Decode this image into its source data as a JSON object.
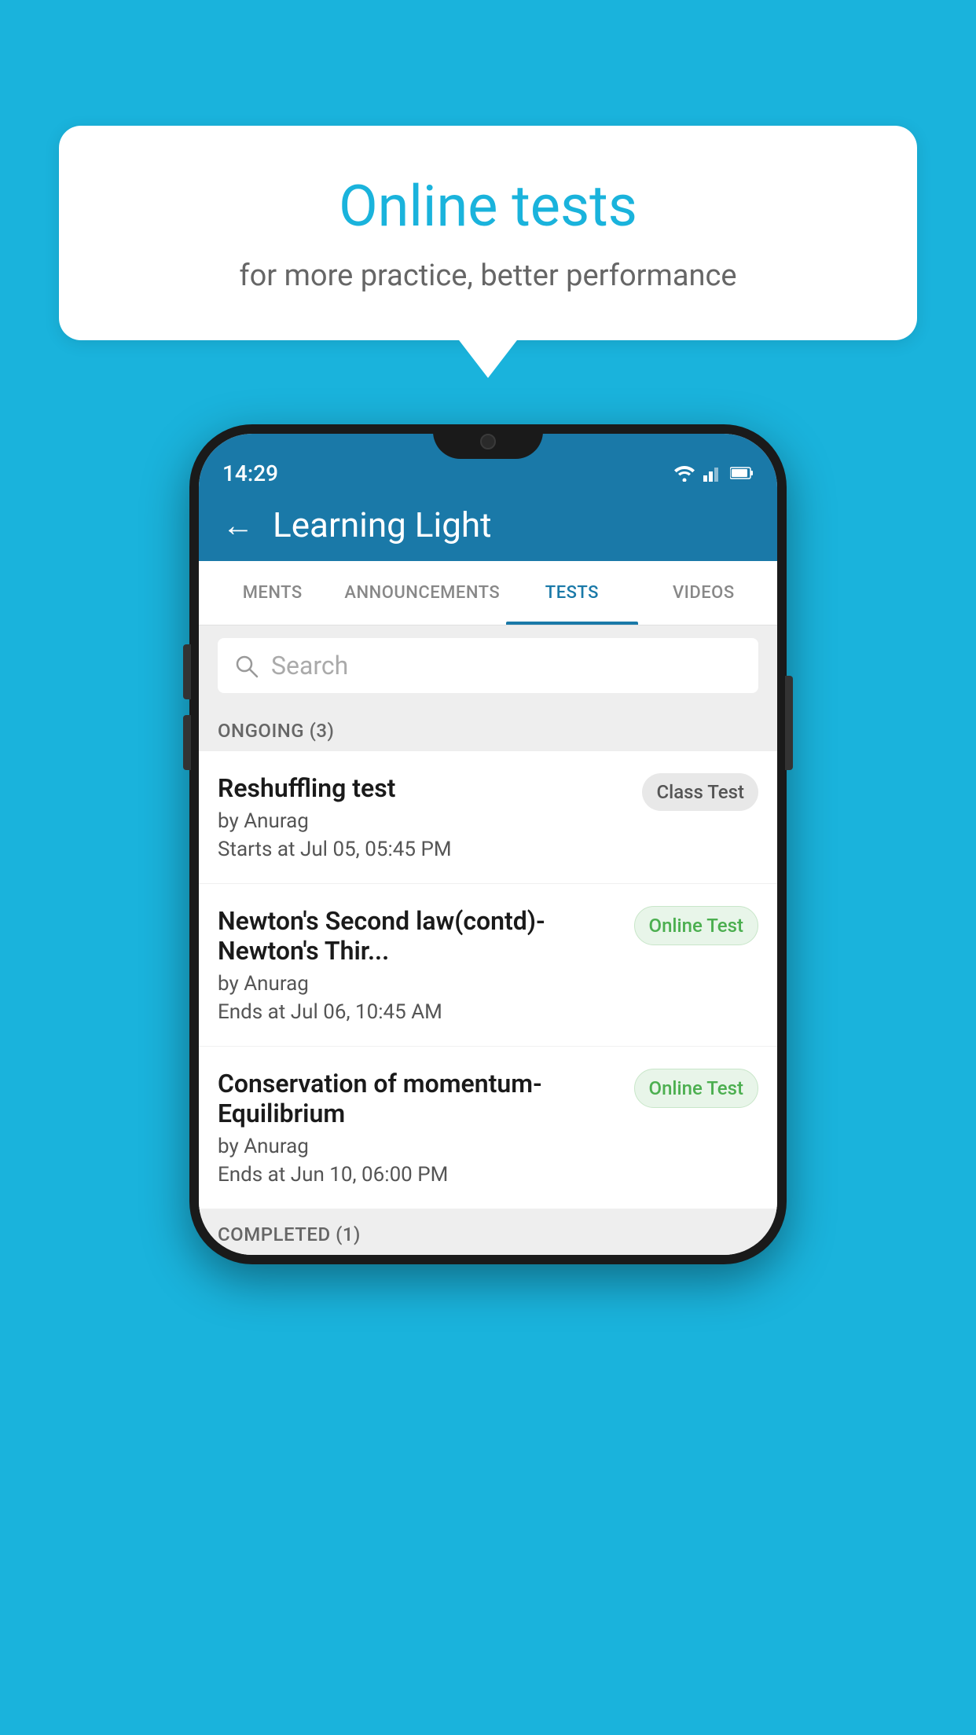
{
  "background": {
    "color": "#1ab3dc"
  },
  "speechBubble": {
    "title": "Online tests",
    "subtitle": "for more practice, better performance"
  },
  "phone": {
    "statusBar": {
      "time": "14:29",
      "icons": [
        "wifi",
        "signal",
        "battery"
      ]
    },
    "appBar": {
      "backLabel": "←",
      "title": "Learning Light"
    },
    "tabs": [
      {
        "label": "MENTS",
        "active": false
      },
      {
        "label": "ANNOUNCEMENTS",
        "active": false
      },
      {
        "label": "TESTS",
        "active": true
      },
      {
        "label": "VIDEOS",
        "active": false
      }
    ],
    "search": {
      "placeholder": "Search"
    },
    "sections": [
      {
        "header": "ONGOING (3)",
        "items": [
          {
            "title": "Reshuffling test",
            "author": "by Anurag",
            "time": "Starts at  Jul 05, 05:45 PM",
            "badge": "Class Test",
            "badgeType": "class"
          },
          {
            "title": "Newton's Second law(contd)-Newton's Thir...",
            "author": "by Anurag",
            "time": "Ends at  Jul 06, 10:45 AM",
            "badge": "Online Test",
            "badgeType": "online"
          },
          {
            "title": "Conservation of momentum-Equilibrium",
            "author": "by Anurag",
            "time": "Ends at  Jun 10, 06:00 PM",
            "badge": "Online Test",
            "badgeType": "online"
          }
        ]
      },
      {
        "header": "COMPLETED (1)",
        "items": []
      }
    ]
  }
}
